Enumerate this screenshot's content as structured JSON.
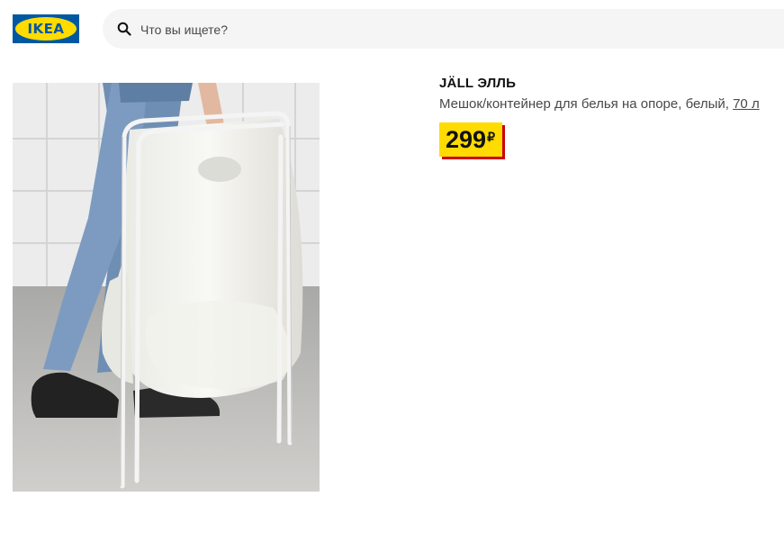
{
  "header": {
    "logo_text": "IKEA",
    "search": {
      "placeholder": "Что вы ищете?",
      "value": ""
    }
  },
  "product": {
    "name": "JÄLL ЭЛЛЬ",
    "description": "Мешок/контейнер для белья на опоре, белый, ",
    "size_link": "70 л",
    "price": {
      "amount": "299",
      "currency": "₽"
    }
  },
  "colors": {
    "brand_blue": "#0058a3",
    "brand_yellow": "#ffdb00",
    "price_shadow": "#cc0008"
  },
  "icons": {
    "search": "search-icon"
  }
}
